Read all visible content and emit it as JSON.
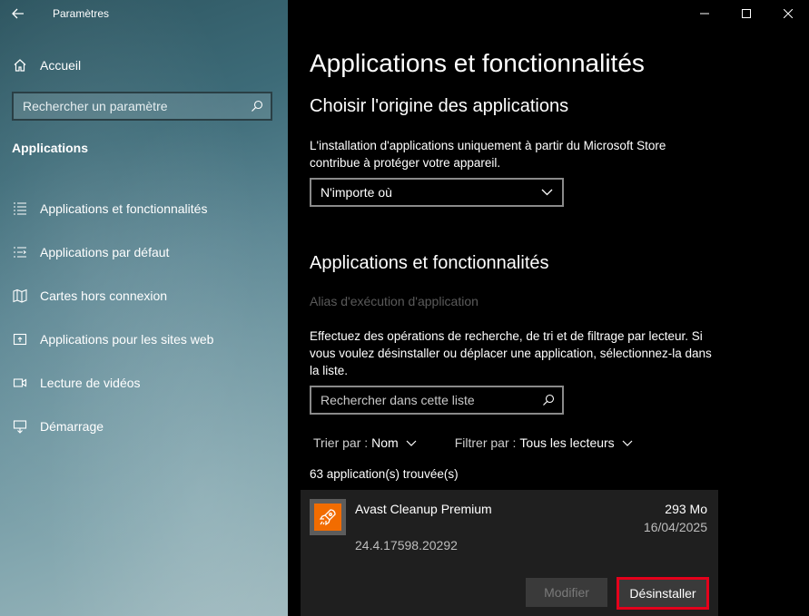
{
  "window": {
    "title": "Paramètres"
  },
  "sidebar": {
    "home_label": "Accueil",
    "search_placeholder": "Rechercher un paramètre",
    "section_title": "Applications",
    "items": [
      {
        "label": "Applications et fonctionnalités",
        "icon": "apps-list-icon"
      },
      {
        "label": "Applications par défaut",
        "icon": "default-apps-icon"
      },
      {
        "label": "Cartes hors connexion",
        "icon": "map-icon"
      },
      {
        "label": "Applications pour les sites web",
        "icon": "web-apps-icon"
      },
      {
        "label": "Lecture de vidéos",
        "icon": "video-icon"
      },
      {
        "label": "Démarrage",
        "icon": "startup-icon"
      }
    ]
  },
  "main": {
    "page_title": "Applications et fonctionnalités",
    "origin": {
      "heading": "Choisir l'origine des applications",
      "description": "L'installation d'applications uniquement à partir du Microsoft Store contribue à protéger votre appareil.",
      "dropdown_value": "N'importe où"
    },
    "apps": {
      "heading": "Applications et fonctionnalités",
      "alias_link": "Alias d'exécution d'application",
      "description": "Effectuez des opérations de recherche, de tri et de filtrage par lecteur. Si vous voulez désinstaller ou déplacer une application, sélectionnez-la dans la liste.",
      "search_placeholder": "Rechercher dans cette liste",
      "sort_key": "Trier par :",
      "sort_value": "Nom",
      "filter_key": "Filtrer par :",
      "filter_value": "Tous les lecteurs",
      "count": "63 application(s) trouvée(s)"
    },
    "selected_app": {
      "name": "Avast Cleanup Premium",
      "size": "293 Mo",
      "date": "16/04/2025",
      "version": "24.4.17598.20292",
      "modify_label": "Modifier",
      "uninstall_label": "Désinstaller",
      "icon_color": "#f26c00"
    }
  },
  "colors": {
    "highlight": "#e4001b",
    "background": "#000000"
  }
}
